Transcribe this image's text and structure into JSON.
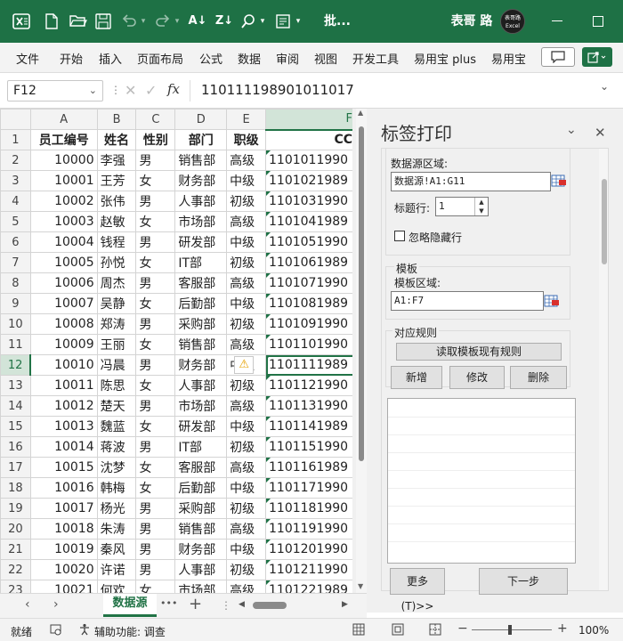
{
  "titlebar": {
    "filename": "批...",
    "user": "表哥 路",
    "avatar_text": "表哥路Excel",
    "icon_names": [
      "excel-logo-icon",
      "new-file-icon",
      "open-folder-icon",
      "save-icon",
      "undo-icon",
      "redo-icon",
      "sort-ascending-icon",
      "sort-descending-icon",
      "search-icon",
      "addin-icon"
    ]
  },
  "menu": {
    "items": [
      "文件",
      "开始",
      "插入",
      "页面布局",
      "公式",
      "数据",
      "审阅",
      "视图",
      "开发工具",
      "易用宝 plus",
      "易用宝"
    ]
  },
  "formula": {
    "cell_ref": "F12",
    "content": "110111198901011017"
  },
  "grid": {
    "col_headers": [
      "A",
      "B",
      "C",
      "D",
      "E",
      "F"
    ],
    "rows": [
      {
        "n": "1",
        "a": "员工编号",
        "b": "姓名",
        "c": "性别",
        "d": "部门",
        "e": "职级",
        "f": "CC"
      },
      {
        "n": "2",
        "a": "10000",
        "b": "李强",
        "c": "男",
        "d": "销售部",
        "e": "高级",
        "f": "1101011990"
      },
      {
        "n": "3",
        "a": "10001",
        "b": "王芳",
        "c": "女",
        "d": "财务部",
        "e": "中级",
        "f": "1101021989"
      },
      {
        "n": "4",
        "a": "10002",
        "b": "张伟",
        "c": "男",
        "d": "人事部",
        "e": "初级",
        "f": "1101031990"
      },
      {
        "n": "5",
        "a": "10003",
        "b": "赵敏",
        "c": "女",
        "d": "市场部",
        "e": "高级",
        "f": "1101041989"
      },
      {
        "n": "6",
        "a": "10004",
        "b": "钱程",
        "c": "男",
        "d": "研发部",
        "e": "中级",
        "f": "1101051990"
      },
      {
        "n": "7",
        "a": "10005",
        "b": "孙悦",
        "c": "女",
        "d": "IT部",
        "e": "初级",
        "f": "1101061989"
      },
      {
        "n": "8",
        "a": "10006",
        "b": "周杰",
        "c": "男",
        "d": "客服部",
        "e": "高级",
        "f": "1101071990"
      },
      {
        "n": "9",
        "a": "10007",
        "b": "吴静",
        "c": "女",
        "d": "后勤部",
        "e": "中级",
        "f": "1101081989"
      },
      {
        "n": "10",
        "a": "10008",
        "b": "郑涛",
        "c": "男",
        "d": "采购部",
        "e": "初级",
        "f": "1101091990"
      },
      {
        "n": "11",
        "a": "10009",
        "b": "王丽",
        "c": "女",
        "d": "销售部",
        "e": "高级",
        "f": "1101101990"
      },
      {
        "n": "12",
        "a": "10010",
        "b": "冯晨",
        "c": "男",
        "d": "财务部",
        "e": "中级",
        "f": "1101111989"
      },
      {
        "n": "13",
        "a": "10011",
        "b": "陈思",
        "c": "女",
        "d": "人事部",
        "e": "初级",
        "f": "1101121990"
      },
      {
        "n": "14",
        "a": "10012",
        "b": "楚天",
        "c": "男",
        "d": "市场部",
        "e": "高级",
        "f": "1101131990"
      },
      {
        "n": "15",
        "a": "10013",
        "b": "魏蓝",
        "c": "女",
        "d": "研发部",
        "e": "中级",
        "f": "1101141989"
      },
      {
        "n": "16",
        "a": "10014",
        "b": "蒋波",
        "c": "男",
        "d": "IT部",
        "e": "初级",
        "f": "1101151990"
      },
      {
        "n": "17",
        "a": "10015",
        "b": "沈梦",
        "c": "女",
        "d": "客服部",
        "e": "高级",
        "f": "1101161989"
      },
      {
        "n": "18",
        "a": "10016",
        "b": "韩梅",
        "c": "女",
        "d": "后勤部",
        "e": "中级",
        "f": "1101171990"
      },
      {
        "n": "19",
        "a": "10017",
        "b": "杨光",
        "c": "男",
        "d": "采购部",
        "e": "初级",
        "f": "1101181990"
      },
      {
        "n": "20",
        "a": "10018",
        "b": "朱涛",
        "c": "男",
        "d": "销售部",
        "e": "高级",
        "f": "1101191990"
      },
      {
        "n": "21",
        "a": "10019",
        "b": "秦风",
        "c": "男",
        "d": "财务部",
        "e": "中级",
        "f": "1101201990"
      },
      {
        "n": "22",
        "a": "10020",
        "b": "许诺",
        "c": "男",
        "d": "人事部",
        "e": "初级",
        "f": "1101211990"
      },
      {
        "n": "23",
        "a": "10021",
        "b": "何欢",
        "c": "女",
        "d": "市场部",
        "e": "高级",
        "f": "1101221989"
      }
    ]
  },
  "panel": {
    "title": "标签打印",
    "datasource_label": "数据源区域:",
    "datasource_value": "数据源!A1:G11",
    "header_row_label": "标题行:",
    "header_row_value": "1",
    "ignore_hidden_label": "忽略隐藏行",
    "template_group": "模板",
    "template_area_label": "模板区域:",
    "template_area_value": "A1:F7",
    "rules_group": "对应规则",
    "read_rules_button": "读取模板现有规则",
    "add_button": "新增",
    "edit_button": "修改",
    "delete_button": "删除",
    "more_button": "更多(T)>>",
    "next_button": "下一步"
  },
  "sheets": {
    "active_tab": "数据源",
    "more": "•••"
  },
  "status": {
    "ready": "就绪",
    "accessibility": "辅助功能: 调查",
    "zoom": "100%"
  },
  "colors": {
    "brand_green": "#1e7145",
    "selection_green": "#217346",
    "panel_bg": "#f0f0f0"
  }
}
